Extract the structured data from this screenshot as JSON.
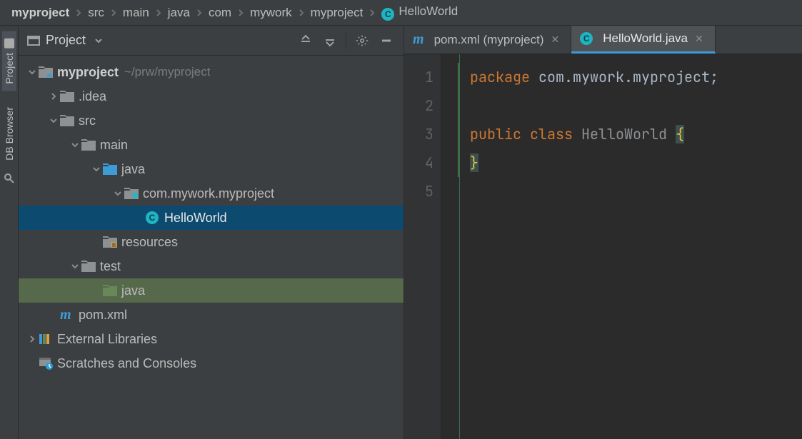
{
  "breadcrumbs": [
    {
      "label": "myproject",
      "bold": true
    },
    {
      "label": "src"
    },
    {
      "label": "main"
    },
    {
      "label": "java"
    },
    {
      "label": "com"
    },
    {
      "label": "mywork"
    },
    {
      "label": "myproject"
    },
    {
      "label": "HelloWorld",
      "icon": "class"
    }
  ],
  "sidetabs": {
    "project": "Project",
    "db": "DB Browser"
  },
  "panel": {
    "title": "Project"
  },
  "tree": {
    "root": {
      "label": "myproject",
      "hint": "~/prw/myproject"
    },
    "idea": ".idea",
    "src": "src",
    "main": "main",
    "java_src": "java",
    "pkg": "com.mywork.myproject",
    "helloworld": "HelloWorld",
    "resources": "resources",
    "test": "test",
    "java_test": "java",
    "pom": "pom.xml",
    "extlib": "External Libraries",
    "scratches": "Scratches and Consoles"
  },
  "tabs": [
    {
      "label": "pom.xml (myproject)",
      "icon": "maven",
      "active": false
    },
    {
      "label": "HelloWorld.java",
      "icon": "class",
      "active": true
    }
  ],
  "code": {
    "lines": [
      "1",
      "2",
      "3",
      "4",
      "5"
    ],
    "line1_kw": "package",
    "line1_pkg": "com.mywork.myproject",
    "line1_semi": ";",
    "line3_kw1": "public",
    "line3_kw2": "class",
    "line3_cls": "HelloWorld",
    "line3_brace": "{",
    "line4_brace": "}"
  }
}
